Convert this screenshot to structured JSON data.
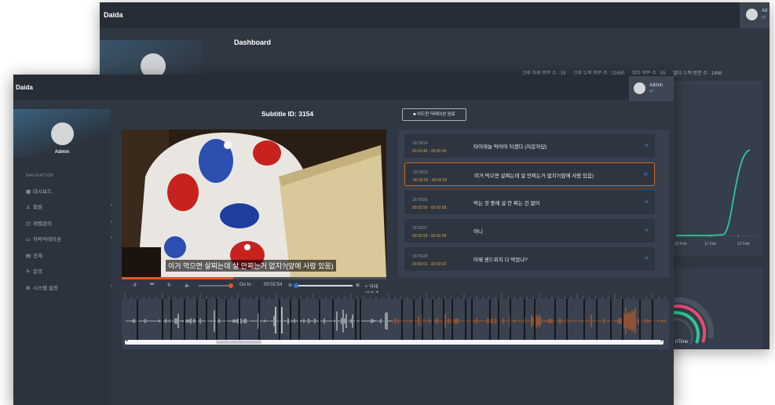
{
  "back_window": {
    "brand": "Daida",
    "user_name": "Ad",
    "user_role": "#7",
    "title": "Dashboard",
    "stats": [
      "크루 하루 방문 수 : 19",
      "크루 누적 방문 수 : 21650",
      "딸다 방문 수 : 55",
      "딸다 누적 방문 수 : 1468"
    ],
    "chart_x_ticks": [
      "10 Feb",
      "11 Feb",
      "12 Feb"
    ],
    "card2_label": "nTime"
  },
  "front_window": {
    "brand": "Daida",
    "user_name": "Admin",
    "user_role": "#7",
    "sidebar": {
      "user_name": "Admin",
      "nav_header": "NAVIGATION",
      "items": [
        {
          "icon": "▦",
          "label": "대시보드",
          "has_children": false
        },
        {
          "icon": "♙",
          "label": "회원",
          "has_children": true
        },
        {
          "icon": "◫",
          "label": "레벨관리",
          "has_children": true
        },
        {
          "icon": "▭",
          "label": "자막딕테이션",
          "has_children": true
        },
        {
          "icon": "▤",
          "label": "공제",
          "has_children": false
        },
        {
          "icon": "✎",
          "label": "문의",
          "has_children": false
        },
        {
          "icon": "⚙",
          "label": "시스템 설정",
          "has_children": true
        }
      ]
    },
    "subtitle_title": "Subtitle ID: 3154",
    "done_button": "■ 어드민 딕테이션 완료",
    "video": {
      "caption": "이거 먹으면 살찌는데 살 안찌는거 없지?(앞에 사람 있음)",
      "progress": 0.42
    },
    "controls": {
      "back_icon": "↺",
      "prev_icon": "⏮",
      "replay_icon": "↻",
      "volume_icon": "🔈",
      "goto_label": "Go to :",
      "goto_value": "00:02:54",
      "zoom_out_icon": "⊖",
      "zoom_in_icon": "⊕",
      "add_label": "+ 딕테이션 추가"
    },
    "dictations": [
      {
        "id": "1673614",
        "time": "00:02:46 - 00:02:49",
        "text": "타이레놀 먹어야 되겠다 (자문자답)",
        "active": false
      },
      {
        "id": "1673625",
        "time": "00:02:52 - 00:02:55",
        "text": "이거 먹으면 살찌는데 살 안찌는거 없지?(앞에 사람 있음)",
        "active": true
      },
      {
        "id": "1673626",
        "time": "00:02:56 - 00:02:58",
        "text": "먹는 것 중에 살 안 찌는 건 없어",
        "active": false
      },
      {
        "id": "1673627",
        "time": "00:02:59 - 00:02:59",
        "text": "아니",
        "active": false
      },
      {
        "id": "1673628",
        "time": "00:03:01 - 00:03:02",
        "text": "어제 샌드위치 다 먹었냐?",
        "active": false
      }
    ],
    "delete_icon": "×",
    "scroll_left": "◂",
    "scroll_right": "▸"
  }
}
